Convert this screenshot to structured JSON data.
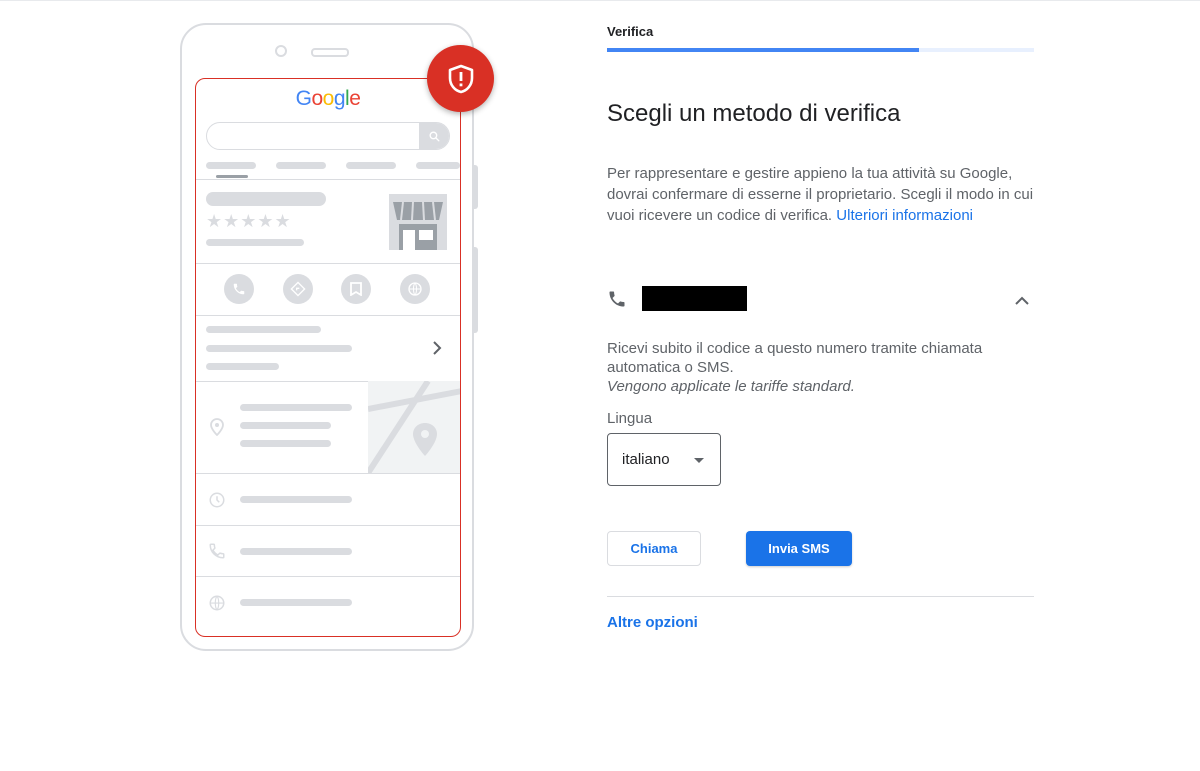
{
  "stepper": {
    "label": "Verifica",
    "progress_fraction": 0.73
  },
  "illustration": {
    "logo": {
      "letters": [
        "G",
        "o",
        "o",
        "g",
        "l",
        "e"
      ]
    },
    "listing_stars": "★★★★★"
  },
  "main": {
    "title": "Scegli un metodo di verifica",
    "description": "Per rappresentare e gestire appieno la tua attività su Google, dovrai confermare di esserne il proprietario. Scegli il modo in cui vuoi ricevere un codice di verifica. ",
    "learn_more_link": "Ulteriori informazioni"
  },
  "phone_option": {
    "icon": "phone-icon",
    "expand_icon": "chevron-up-icon",
    "info_line": "Ricevi subito il codice a questo numero tramite chiamata automatica o SMS.",
    "info_note": "Vengono applicate le tariffe standard."
  },
  "language": {
    "label": "Lingua",
    "selected": "italiano"
  },
  "actions": {
    "call_label": "Chiama",
    "sms_label": "Invia SMS"
  },
  "more_options": "Altre opzioni",
  "colors": {
    "accent": "#1a73e8",
    "alert": "#d93025",
    "progress": "#4285f4"
  }
}
